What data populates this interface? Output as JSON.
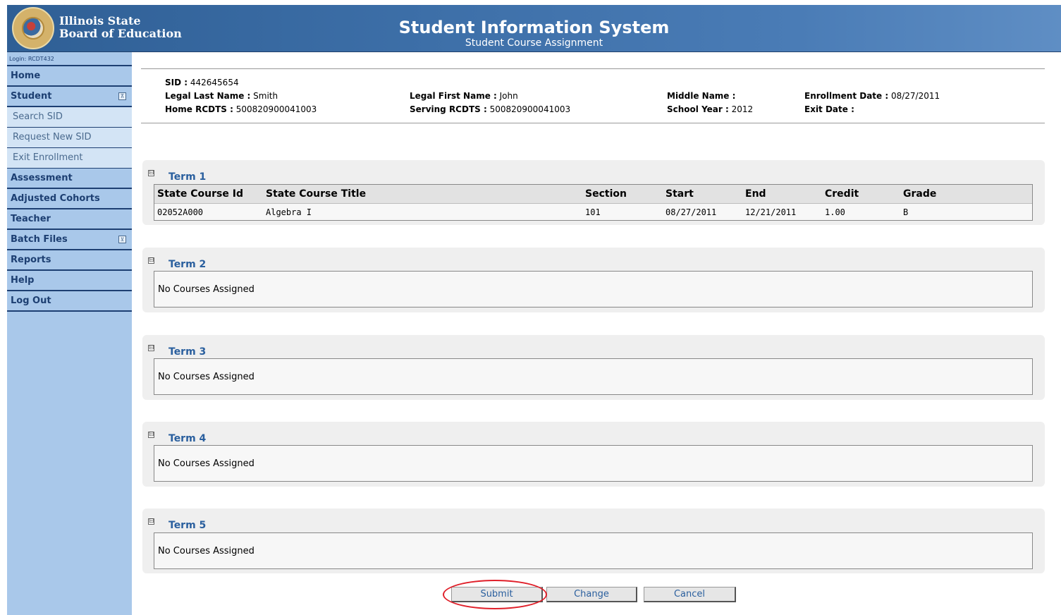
{
  "header": {
    "org_line1": "Illinois State",
    "org_line2": "Board of Education",
    "title": "Student Information System",
    "subtitle": "Student Course Assignment"
  },
  "sidebar": {
    "login": "Login: RCDT432",
    "items": [
      {
        "label": "Home"
      },
      {
        "label": "Student",
        "toggle": "⊼"
      },
      {
        "label": "Search SID"
      },
      {
        "label": "Request New SID"
      },
      {
        "label": "Exit Enrollment"
      },
      {
        "label": "Assessment"
      },
      {
        "label": "Adjusted Cohorts"
      },
      {
        "label": "Teacher"
      },
      {
        "label": "Batch Files",
        "toggle": "⊻"
      },
      {
        "label": "Reports"
      },
      {
        "label": "Help"
      },
      {
        "label": "Log Out"
      }
    ]
  },
  "student": {
    "sid_label": "SID :",
    "sid": "442645654",
    "last_name_label": "Legal Last Name :",
    "last_name": "Smith",
    "first_name_label": "Legal First Name :",
    "first_name": "John",
    "middle_name_label": "Middle Name :",
    "middle_name": "",
    "enrollment_date_label": "Enrollment Date :",
    "enrollment_date": "08/27/2011",
    "home_rcdts_label": "Home RCDTS :",
    "home_rcdts": "500820900041003",
    "serving_rcdts_label": "Serving RCDTS :",
    "serving_rcdts": "500820900041003",
    "school_year_label": "School Year :",
    "school_year": "2012",
    "exit_date_label": "Exit Date :",
    "exit_date": ""
  },
  "table_headers": [
    "State Course Id",
    "State Course Title",
    "Section",
    "Start",
    "End",
    "Credit",
    "Grade"
  ],
  "terms": [
    {
      "title": "Term 1",
      "courses": [
        {
          "id": "02052A000",
          "title": "Algebra I",
          "section": "101",
          "start": "08/27/2011",
          "end": "12/21/2011",
          "credit": "1.00",
          "grade": "B"
        }
      ]
    },
    {
      "title": "Term 2",
      "empty_text": "No Courses Assigned"
    },
    {
      "title": "Term 3",
      "empty_text": "No Courses Assigned"
    },
    {
      "title": "Term 4",
      "empty_text": "No Courses Assigned"
    },
    {
      "title": "Term 5",
      "empty_text": "No Courses Assigned"
    }
  ],
  "toggle_symbol": "⊟",
  "buttons": {
    "submit": "Submit",
    "change": "Change",
    "cancel": "Cancel"
  },
  "colors": {
    "header_blue": "#2f5f95",
    "sidebar_blue": "#a9c8ea",
    "link_blue": "#2a5f9e",
    "highlight_red": "#e0202a"
  }
}
